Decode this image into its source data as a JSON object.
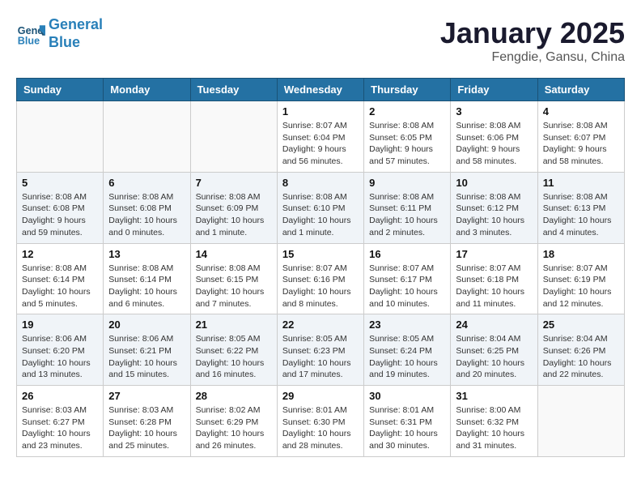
{
  "header": {
    "logo_line1": "General",
    "logo_line2": "Blue",
    "month_title": "January 2025",
    "location": "Fengdie, Gansu, China"
  },
  "days_of_week": [
    "Sunday",
    "Monday",
    "Tuesday",
    "Wednesday",
    "Thursday",
    "Friday",
    "Saturday"
  ],
  "weeks": [
    [
      {
        "num": "",
        "info": ""
      },
      {
        "num": "",
        "info": ""
      },
      {
        "num": "",
        "info": ""
      },
      {
        "num": "1",
        "info": "Sunrise: 8:07 AM\nSunset: 6:04 PM\nDaylight: 9 hours\nand 56 minutes."
      },
      {
        "num": "2",
        "info": "Sunrise: 8:08 AM\nSunset: 6:05 PM\nDaylight: 9 hours\nand 57 minutes."
      },
      {
        "num": "3",
        "info": "Sunrise: 8:08 AM\nSunset: 6:06 PM\nDaylight: 9 hours\nand 58 minutes."
      },
      {
        "num": "4",
        "info": "Sunrise: 8:08 AM\nSunset: 6:07 PM\nDaylight: 9 hours\nand 58 minutes."
      }
    ],
    [
      {
        "num": "5",
        "info": "Sunrise: 8:08 AM\nSunset: 6:08 PM\nDaylight: 9 hours\nand 59 minutes."
      },
      {
        "num": "6",
        "info": "Sunrise: 8:08 AM\nSunset: 6:08 PM\nDaylight: 10 hours\nand 0 minutes."
      },
      {
        "num": "7",
        "info": "Sunrise: 8:08 AM\nSunset: 6:09 PM\nDaylight: 10 hours\nand 1 minute."
      },
      {
        "num": "8",
        "info": "Sunrise: 8:08 AM\nSunset: 6:10 PM\nDaylight: 10 hours\nand 1 minute."
      },
      {
        "num": "9",
        "info": "Sunrise: 8:08 AM\nSunset: 6:11 PM\nDaylight: 10 hours\nand 2 minutes."
      },
      {
        "num": "10",
        "info": "Sunrise: 8:08 AM\nSunset: 6:12 PM\nDaylight: 10 hours\nand 3 minutes."
      },
      {
        "num": "11",
        "info": "Sunrise: 8:08 AM\nSunset: 6:13 PM\nDaylight: 10 hours\nand 4 minutes."
      }
    ],
    [
      {
        "num": "12",
        "info": "Sunrise: 8:08 AM\nSunset: 6:14 PM\nDaylight: 10 hours\nand 5 minutes."
      },
      {
        "num": "13",
        "info": "Sunrise: 8:08 AM\nSunset: 6:14 PM\nDaylight: 10 hours\nand 6 minutes."
      },
      {
        "num": "14",
        "info": "Sunrise: 8:08 AM\nSunset: 6:15 PM\nDaylight: 10 hours\nand 7 minutes."
      },
      {
        "num": "15",
        "info": "Sunrise: 8:07 AM\nSunset: 6:16 PM\nDaylight: 10 hours\nand 8 minutes."
      },
      {
        "num": "16",
        "info": "Sunrise: 8:07 AM\nSunset: 6:17 PM\nDaylight: 10 hours\nand 10 minutes."
      },
      {
        "num": "17",
        "info": "Sunrise: 8:07 AM\nSunset: 6:18 PM\nDaylight: 10 hours\nand 11 minutes."
      },
      {
        "num": "18",
        "info": "Sunrise: 8:07 AM\nSunset: 6:19 PM\nDaylight: 10 hours\nand 12 minutes."
      }
    ],
    [
      {
        "num": "19",
        "info": "Sunrise: 8:06 AM\nSunset: 6:20 PM\nDaylight: 10 hours\nand 13 minutes."
      },
      {
        "num": "20",
        "info": "Sunrise: 8:06 AM\nSunset: 6:21 PM\nDaylight: 10 hours\nand 15 minutes."
      },
      {
        "num": "21",
        "info": "Sunrise: 8:05 AM\nSunset: 6:22 PM\nDaylight: 10 hours\nand 16 minutes."
      },
      {
        "num": "22",
        "info": "Sunrise: 8:05 AM\nSunset: 6:23 PM\nDaylight: 10 hours\nand 17 minutes."
      },
      {
        "num": "23",
        "info": "Sunrise: 8:05 AM\nSunset: 6:24 PM\nDaylight: 10 hours\nand 19 minutes."
      },
      {
        "num": "24",
        "info": "Sunrise: 8:04 AM\nSunset: 6:25 PM\nDaylight: 10 hours\nand 20 minutes."
      },
      {
        "num": "25",
        "info": "Sunrise: 8:04 AM\nSunset: 6:26 PM\nDaylight: 10 hours\nand 22 minutes."
      }
    ],
    [
      {
        "num": "26",
        "info": "Sunrise: 8:03 AM\nSunset: 6:27 PM\nDaylight: 10 hours\nand 23 minutes."
      },
      {
        "num": "27",
        "info": "Sunrise: 8:03 AM\nSunset: 6:28 PM\nDaylight: 10 hours\nand 25 minutes."
      },
      {
        "num": "28",
        "info": "Sunrise: 8:02 AM\nSunset: 6:29 PM\nDaylight: 10 hours\nand 26 minutes."
      },
      {
        "num": "29",
        "info": "Sunrise: 8:01 AM\nSunset: 6:30 PM\nDaylight: 10 hours\nand 28 minutes."
      },
      {
        "num": "30",
        "info": "Sunrise: 8:01 AM\nSunset: 6:31 PM\nDaylight: 10 hours\nand 30 minutes."
      },
      {
        "num": "31",
        "info": "Sunrise: 8:00 AM\nSunset: 6:32 PM\nDaylight: 10 hours\nand 31 minutes."
      },
      {
        "num": "",
        "info": ""
      }
    ]
  ]
}
